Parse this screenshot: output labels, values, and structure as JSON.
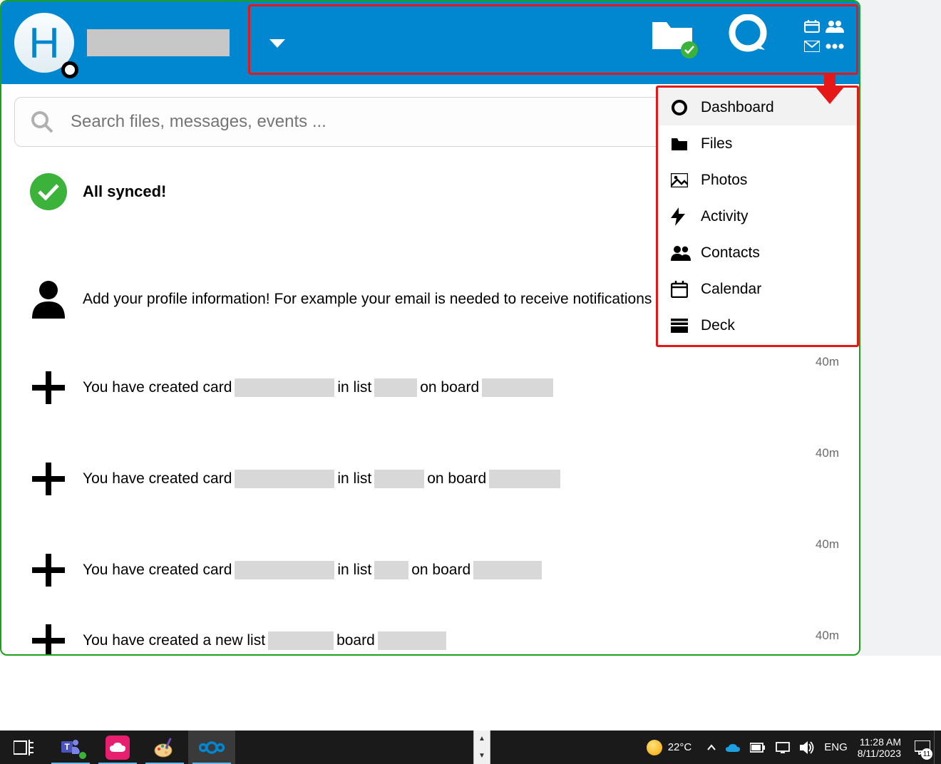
{
  "avatar_letter": "H",
  "search": {
    "placeholder": "Search files, messages, events ..."
  },
  "menu": [
    {
      "id": "dashboard",
      "label": "Dashboard",
      "selected": true
    },
    {
      "id": "files",
      "label": "Files"
    },
    {
      "id": "photos",
      "label": "Photos"
    },
    {
      "id": "activity",
      "label": "Activity"
    },
    {
      "id": "contacts",
      "label": "Contacts"
    },
    {
      "id": "calendar",
      "label": "Calendar"
    },
    {
      "id": "deck",
      "label": "Deck"
    }
  ],
  "feed": {
    "synced_label": "All synced!",
    "profile_hint": "Add your profile information! For example your email is needed to receive notifications and reset your password.",
    "card": {
      "pre": "You have created card ",
      "mid1": " in list ",
      "mid2": " on board "
    },
    "list": {
      "pre": "You have created a new list ",
      "mid": " board"
    },
    "ts": "40m"
  },
  "taskbar": {
    "temp": "22°C",
    "lang": "ENG",
    "time": "11:28 AM",
    "date": "8/11/2023",
    "notif_count": "11"
  }
}
